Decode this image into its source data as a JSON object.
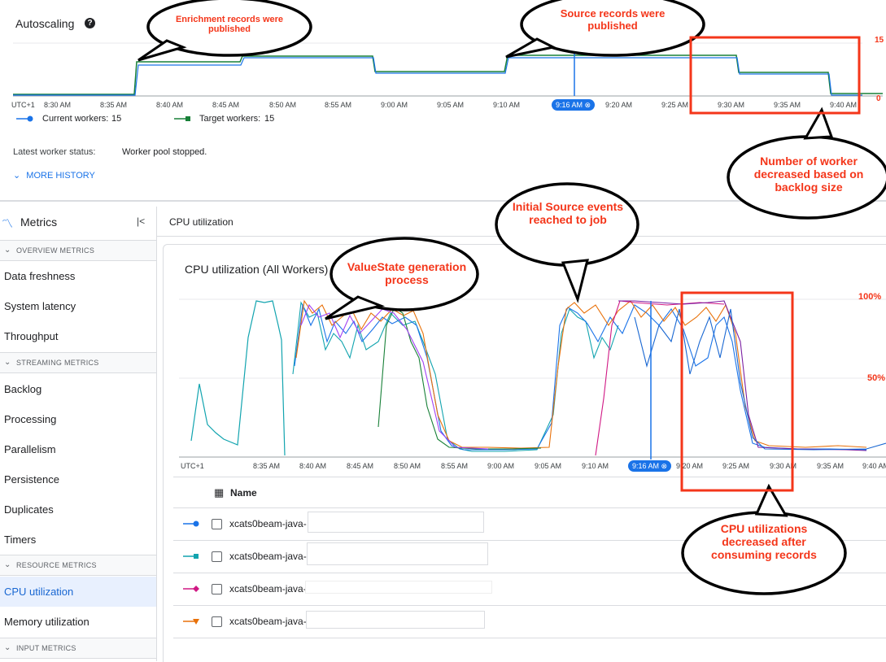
{
  "autoscaling": {
    "title": "Autoscaling",
    "y_max_label": "15",
    "y_min_label": "0",
    "timezone": "UTC+1",
    "ticks": [
      "8:30 AM",
      "8:35 AM",
      "8:40 AM",
      "8:45 AM",
      "8:50 AM",
      "8:55 AM",
      "9:00 AM",
      "9:05 AM",
      "9:10 AM",
      "9:20 AM",
      "9:25 AM",
      "9:30 AM",
      "9:35 AM",
      "9:40 AM"
    ],
    "cursor_time": "9:16 AM",
    "legend": [
      {
        "label": "Current workers:",
        "value": "15",
        "color": "#1a73e8"
      },
      {
        "label": "Target workers:",
        "value": "15",
        "color": "#188038"
      }
    ],
    "status_label": "Latest worker status:",
    "status_value": "Worker pool stopped.",
    "more_history": "MORE HISTORY"
  },
  "sidebar": {
    "title": "Metrics",
    "sections": [
      {
        "heading": "OVERVIEW METRICS",
        "items": [
          "Data freshness",
          "System latency",
          "Throughput"
        ]
      },
      {
        "heading": "STREAMING METRICS",
        "items": [
          "Backlog",
          "Processing",
          "Parallelism",
          "Persistence",
          "Duplicates",
          "Timers"
        ]
      },
      {
        "heading": "RESOURCE METRICS",
        "items": [
          "CPU utilization",
          "Memory utilization"
        ]
      },
      {
        "heading": "INPUT METRICS",
        "items": []
      }
    ],
    "selected": "CPU utilization"
  },
  "main": {
    "page_title": "CPU utilization",
    "chart_title": "CPU utilization (All Workers)",
    "y_labels": [
      "100%",
      "50%"
    ],
    "timezone": "UTC+1",
    "ticks": [
      "8:35 AM",
      "8:40 AM",
      "8:45 AM",
      "8:50 AM",
      "8:55 AM",
      "9:00 AM",
      "9:05 AM",
      "9:10 AM",
      "9:20 AM",
      "9:25 AM",
      "9:30 AM",
      "9:35 AM",
      "9:40 AM"
    ],
    "cursor_time": "9:16 AM",
    "table_header": "Name",
    "rows": [
      {
        "name": "xcats0beam-java-",
        "color": "#1a73e8",
        "marker": "circle"
      },
      {
        "name": "xcats0beam-java-",
        "color": "#12a4af",
        "marker": "square"
      },
      {
        "name": "xcats0beam-java-",
        "color": "#d01884",
        "marker": "diamond"
      },
      {
        "name": "xcats0beam-java-",
        "color": "#e8710a",
        "marker": "triangle"
      }
    ]
  },
  "annotations": {
    "enrichment": "Enrichment records were published",
    "source": "Source records were published",
    "workers": "Number of worker decreased based on backlog size",
    "initial": "Initial Source events reached to job",
    "valuestate": "ValueState generation process",
    "cpu": "CPU utilizations decreased after consuming records"
  },
  "colors": {
    "accent": "#1a73e8",
    "annotation": "#f4361a",
    "highlight_box": "#f4361a"
  }
}
